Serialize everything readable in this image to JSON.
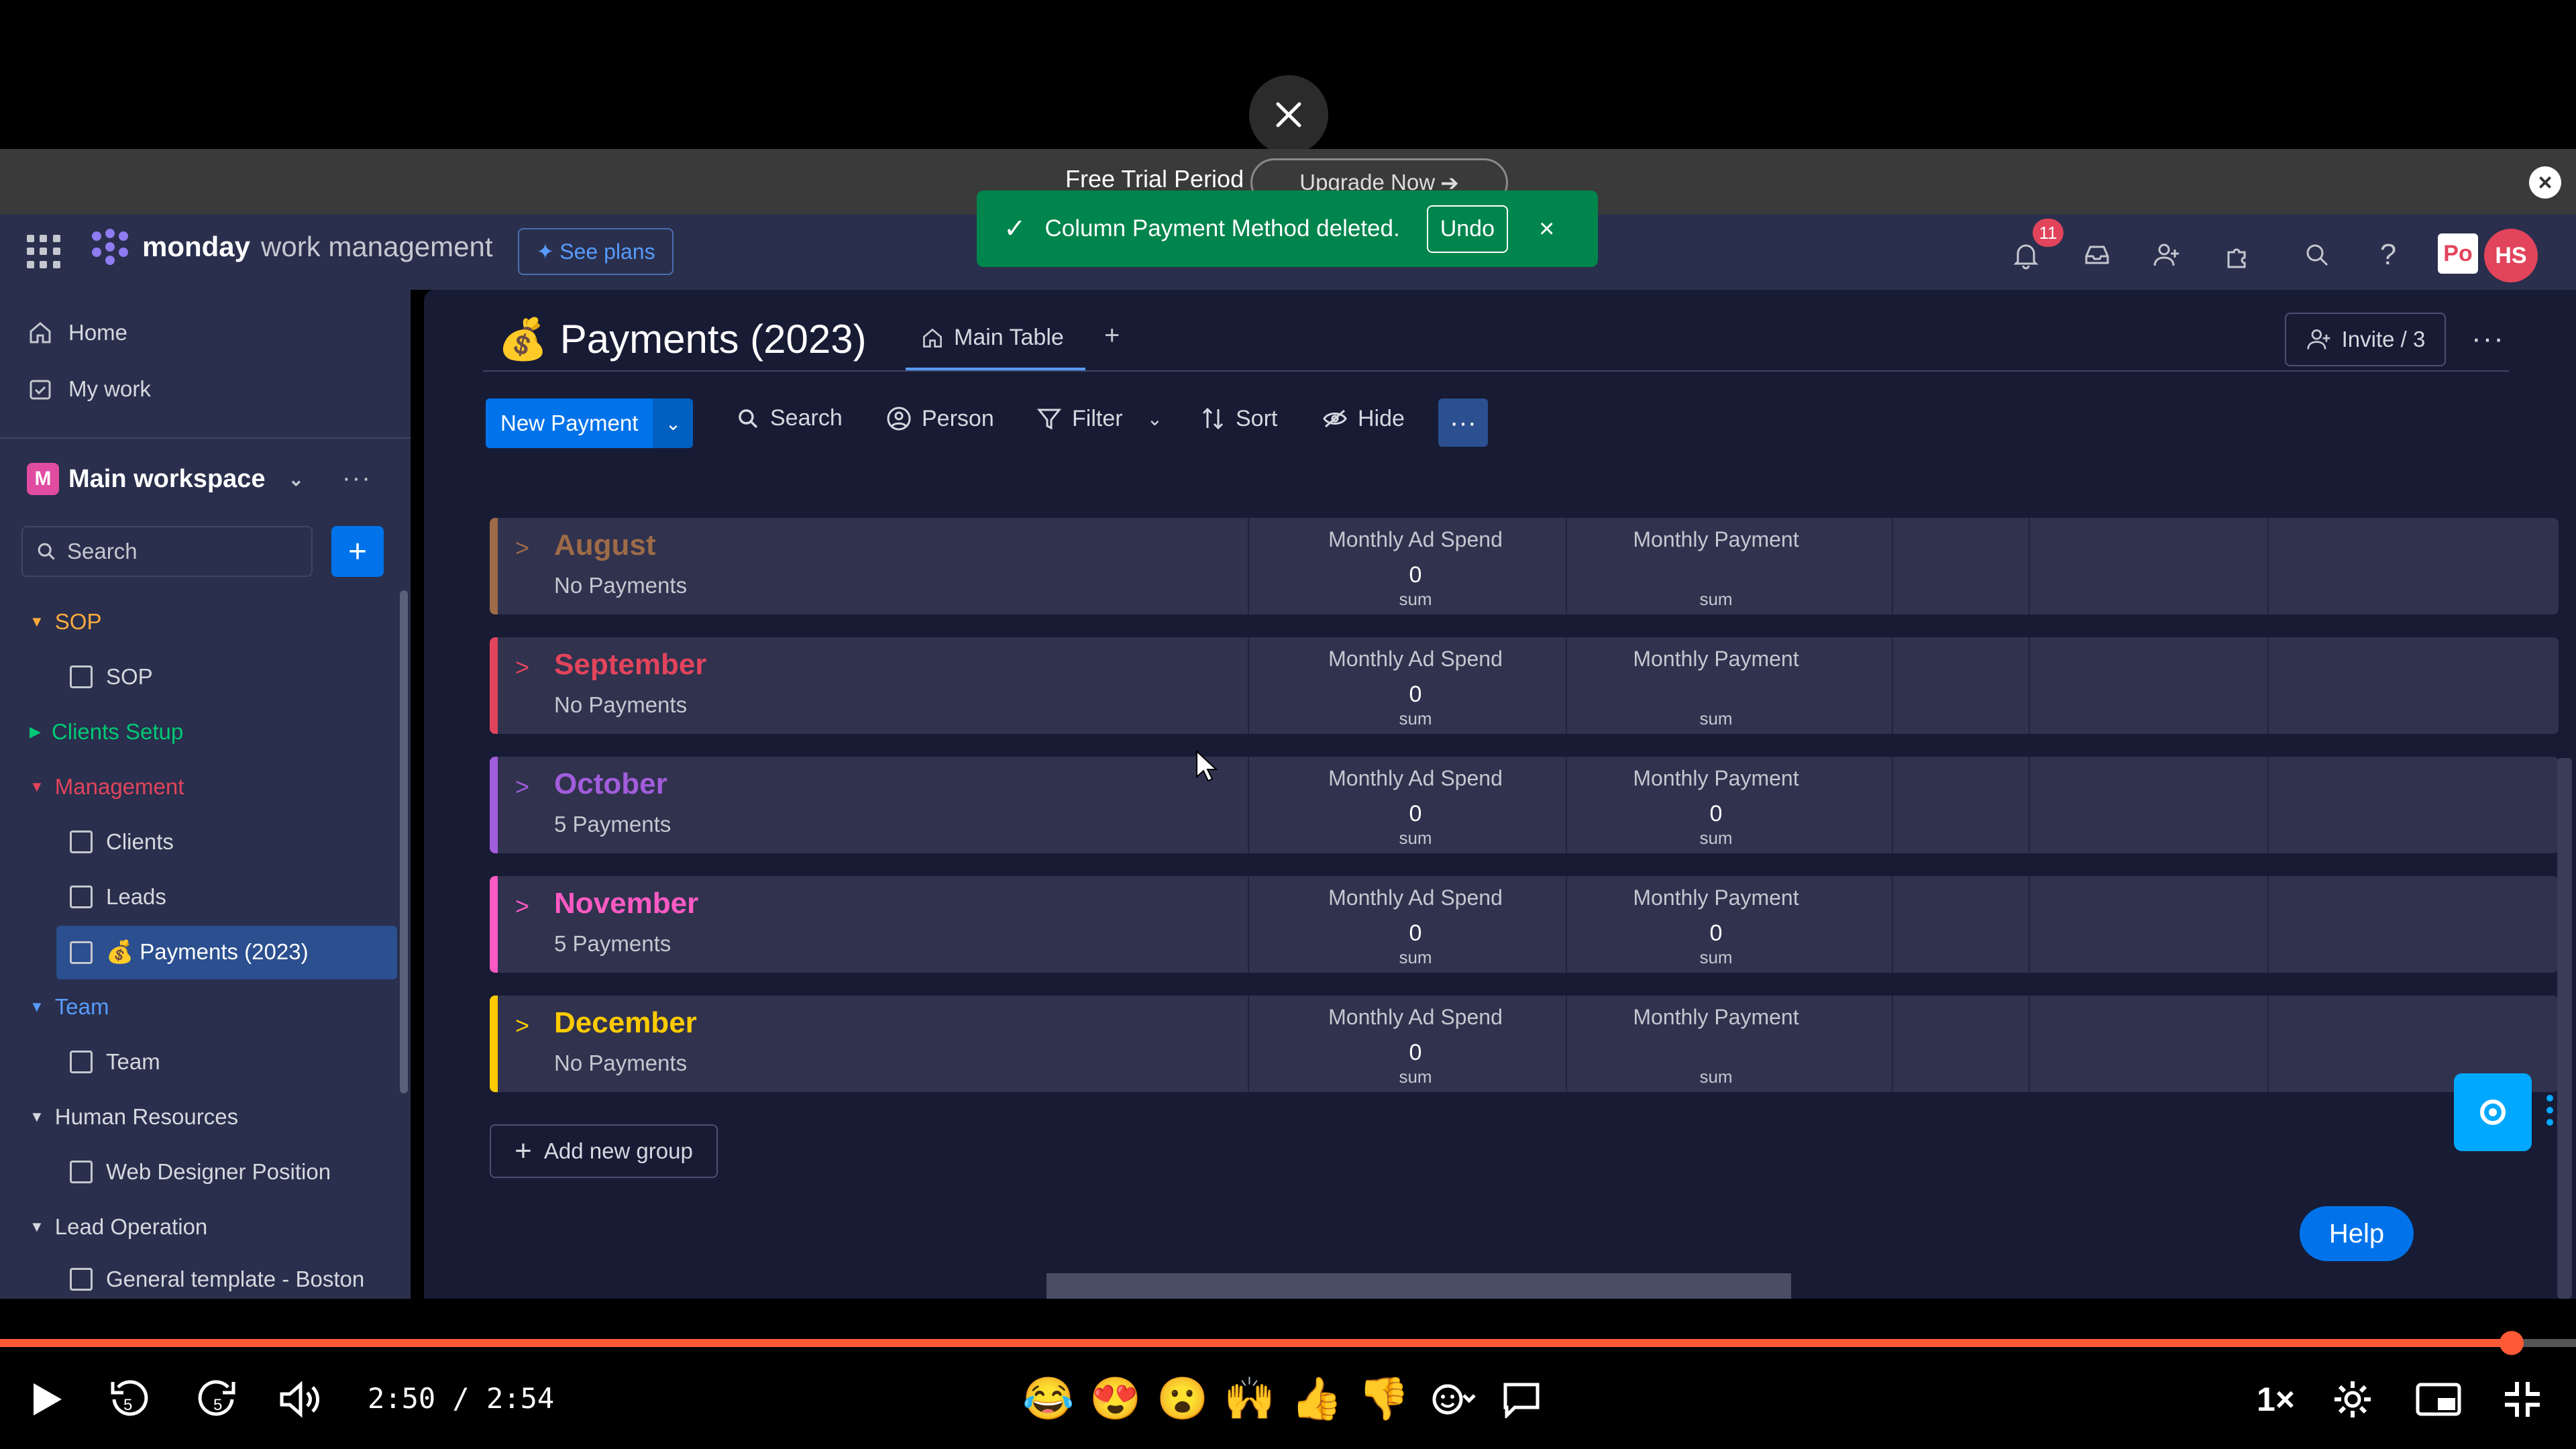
{
  "banner": {
    "trial_text": "Free Trial Period",
    "upgrade_label": "Upgrade Now"
  },
  "header": {
    "brand": "monday",
    "product": "work management",
    "see_plans": "See plans",
    "notifications_count": "11",
    "po_badge": "Po",
    "avatar_initials": "HS"
  },
  "toast": {
    "message": "Column Payment Method deleted.",
    "undo_label": "Undo"
  },
  "sidebar": {
    "home": "Home",
    "my_work": "My work",
    "workspace": {
      "badge": "M",
      "name": "Main workspace"
    },
    "search_placeholder": "Search",
    "tree": [
      {
        "folder": "SOP",
        "color": "#fdab3d",
        "expanded": true,
        "boards": [
          "SOP"
        ]
      },
      {
        "folder": "Clients Setup",
        "color": "#00c875",
        "expanded": false,
        "boards": []
      },
      {
        "folder": "Management",
        "color": "#e2445c",
        "expanded": true,
        "boards": [
          "Clients",
          "Leads",
          "Payments (2023)"
        ]
      },
      {
        "folder": "Team",
        "color": "#579bfc",
        "expanded": true,
        "boards": [
          "Team"
        ]
      },
      {
        "folder": "Human Resources",
        "color": "#d5d8df",
        "expanded": true,
        "boards": [
          "Web Designer Position"
        ]
      },
      {
        "folder": "Lead Operation",
        "color": "#d5d8df",
        "expanded": true,
        "boards": [
          "General template - Boston"
        ]
      }
    ]
  },
  "board": {
    "title": "Payments (2023)",
    "tab_main": "Main Table",
    "invite": "Invite / 3",
    "toolbar": {
      "new_item": "New Payment",
      "search": "Search",
      "person": "Person",
      "filter": "Filter",
      "sort": "Sort",
      "hide": "Hide"
    },
    "columns": [
      "Monthly Ad Spend",
      "Monthly Payment"
    ],
    "sum_label": "sum",
    "groups": [
      {
        "name": "August",
        "count": "No Payments",
        "color": "#9d6b48",
        "ad_spend": "0",
        "payment": ""
      },
      {
        "name": "September",
        "count": "No Payments",
        "color": "#e2445c",
        "ad_spend": "0",
        "payment": ""
      },
      {
        "name": "October",
        "count": "5 Payments",
        "color": "#a25ddc",
        "ad_spend": "0",
        "payment": "0"
      },
      {
        "name": "November",
        "count": "5 Payments",
        "color": "#ff5ac4",
        "ad_spend": "0",
        "payment": "0"
      },
      {
        "name": "December",
        "count": "No Payments",
        "color": "#ffcb00",
        "ad_spend": "0",
        "payment": ""
      }
    ],
    "add_group": "Add new group",
    "help": "Help"
  },
  "player": {
    "time": "2:50 / 2:54",
    "speed": "1×",
    "progress": 0.975,
    "emojis": [
      "😂",
      "😍",
      "😮",
      "🙌",
      "👍",
      "👎"
    ]
  }
}
